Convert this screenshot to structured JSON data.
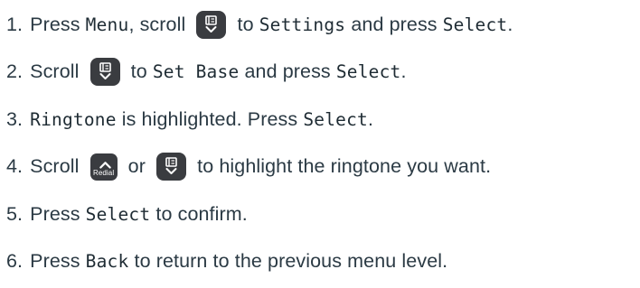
{
  "steps": [
    {
      "num": "1.",
      "t1": "Press ",
      "k1": "Menu",
      "t2": ", scroll ",
      "icon": "phonebook-down-icon",
      "t3": " to ",
      "k2": "Settings",
      "t4": " and press ",
      "k3": "Select",
      "t5": "."
    },
    {
      "num": "2.",
      "t1": "Scroll ",
      "icon": "phonebook-down-icon",
      "t2": " to ",
      "k1": "Set Base",
      "t3": " and press ",
      "k2": "Select",
      "t4": "."
    },
    {
      "num": "3.",
      "k1": "Ringtone",
      "t1": " is highlighted. Press ",
      "k2": "Select",
      "t2": "."
    },
    {
      "num": "4.",
      "t1": "Scroll ",
      "icon1": "redial-up-icon",
      "redial_label": "Redial",
      "t2": " or ",
      "icon2": "phonebook-down-icon",
      "t3": " to highlight the ringtone you want."
    },
    {
      "num": "5.",
      "t1": "Press ",
      "k1": "Select",
      "t2": " to confirm."
    },
    {
      "num": "6.",
      "t1": "Press ",
      "k1": "Back",
      "t2": " to return to the previous menu level."
    }
  ]
}
